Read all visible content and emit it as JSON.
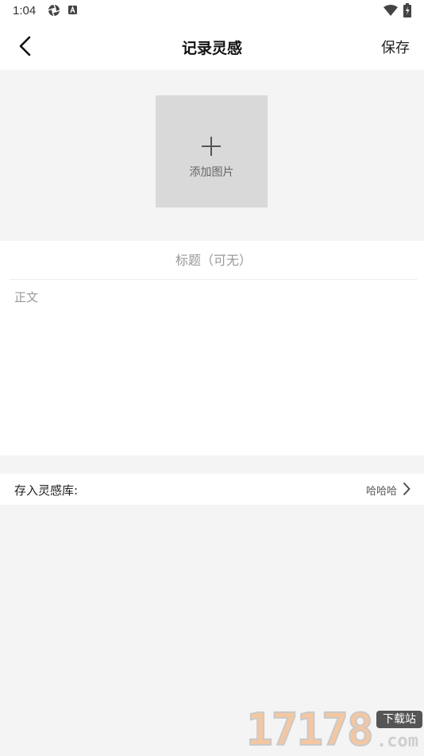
{
  "status_bar": {
    "time": "1:04",
    "icons": [
      "aperture-icon",
      "a-badge-icon",
      "wifi-icon",
      "battery-charging-icon"
    ]
  },
  "header": {
    "title": "记录灵感",
    "save_label": "保存",
    "back_icon": "chevron-left-icon"
  },
  "image_picker": {
    "icon": "plus-icon",
    "label": "添加图片",
    "tile_color": "#d9d9d9"
  },
  "editor": {
    "title_placeholder": "标题（可无）",
    "title_value": "",
    "body_placeholder": "正文",
    "body_value": ""
  },
  "library": {
    "label": "存入灵感库:",
    "value": "哈哈哈",
    "icon": "chevron-right-icon"
  },
  "watermark": {
    "digits": "17178",
    "badge": "下载站",
    "domain": ".com"
  },
  "colors": {
    "page_background": "#f4f4f4",
    "surface": "#ffffff",
    "placeholder_text": "#999999"
  }
}
